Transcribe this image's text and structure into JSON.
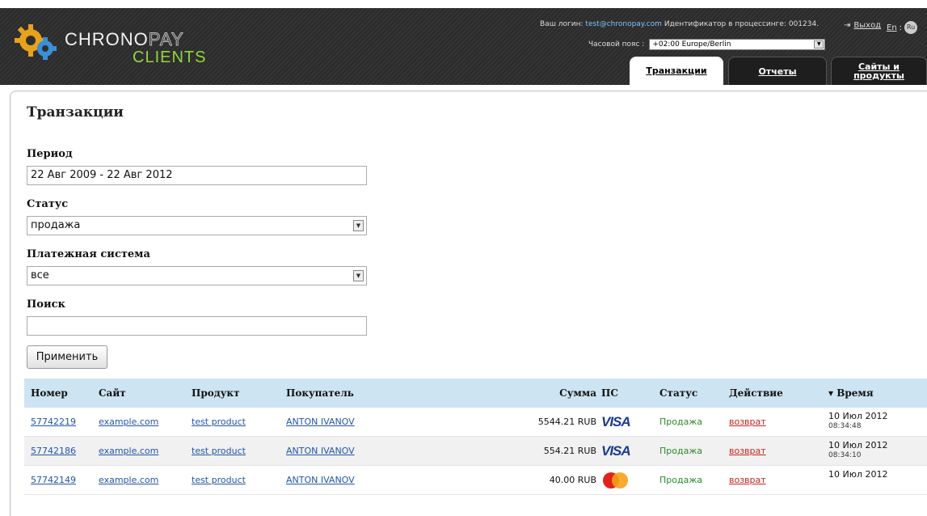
{
  "header": {
    "brand_word1": "CHRONO",
    "brand_word2": "PAY",
    "brand_sub": "CLIENTS",
    "login_label": "Ваш логин:",
    "login_email": "test@chronopay.com",
    "processing_label": "Идентификатор в процессинге:",
    "processing_id": "001234.",
    "timezone_label": "Часовой пояс :",
    "timezone_value": "+02:00 Europe/Berlin",
    "logout_label": "Выход",
    "lang_en": "En",
    "lang_sep": ":",
    "lang_ru": "Ru",
    "tabs": [
      {
        "label": "Транзакции",
        "active": true
      },
      {
        "label": "Отчеты",
        "active": false
      },
      {
        "label": "Сайты и продукты",
        "active": false
      }
    ]
  },
  "filters": {
    "page_title": "Транзакции",
    "period_label": "Период",
    "period_value": "22 Авг 2009 - 22 Авг 2012",
    "status_label": "Статус",
    "status_value": "продажа",
    "payment_label": "Платежная система",
    "payment_value": "все",
    "search_label": "Поиск",
    "search_value": "",
    "apply_label": "Применить"
  },
  "table": {
    "headers": [
      "Номер",
      "Сайт",
      "Продукт",
      "Покупатель",
      "Сумма",
      "ПС",
      "Статус",
      "Действие",
      "Время"
    ],
    "sort_indicator": "▾",
    "rows": [
      {
        "id": "57742219",
        "site": "example.com",
        "product": "test product",
        "buyer": "ANTON IVANOV",
        "amount": "5544.21 RUB",
        "ps": "VISA",
        "ps_icon": "visa-icon",
        "status": "Продажа",
        "action": "возврат",
        "date": "10 Июл 2012",
        "time": "08:34:48"
      },
      {
        "id": "57742186",
        "site": "example.com",
        "product": "test product",
        "buyer": "ANTON IVANOV",
        "amount": "554.21 RUB",
        "ps": "VISA",
        "ps_icon": "visa-icon",
        "status": "Продажа",
        "action": "возврат",
        "date": "10 Июл 2012",
        "time": "08:34:10"
      },
      {
        "id": "57742149",
        "site": "example.com",
        "product": "test product",
        "buyer": "ANTON IVANOV",
        "amount": "40.00 RUB",
        "ps": "MasterCard",
        "ps_icon": "mastercard-icon",
        "status": "Продажа",
        "action": "возврат",
        "date": "10 Июл 2012",
        "time": ""
      }
    ]
  }
}
